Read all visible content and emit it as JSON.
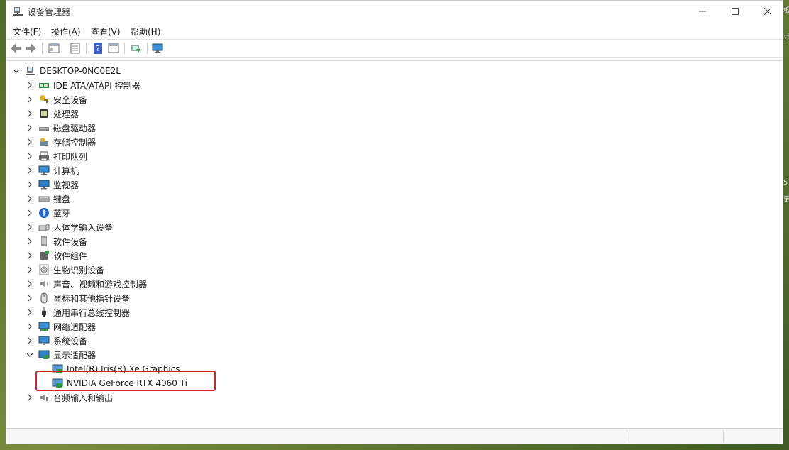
{
  "window": {
    "title": "设备管理器"
  },
  "menubar": {
    "items": [
      "文件(F)",
      "操作(A)",
      "查看(V)",
      "帮助(H)"
    ]
  },
  "tree": {
    "root": "DESKTOP-0NC0E2L",
    "categories": [
      {
        "label": "IDE ATA/ATAPI 控制器",
        "icon": "ide-controller-icon",
        "expanded": false
      },
      {
        "label": "安全设备",
        "icon": "security-key-icon",
        "expanded": false
      },
      {
        "label": "处理器",
        "icon": "processor-icon",
        "expanded": false
      },
      {
        "label": "磁盘驱动器",
        "icon": "disk-drive-icon",
        "expanded": false
      },
      {
        "label": "存储控制器",
        "icon": "storage-controller-icon",
        "expanded": false
      },
      {
        "label": "打印队列",
        "icon": "printer-icon",
        "expanded": false
      },
      {
        "label": "计算机",
        "icon": "computer-icon",
        "expanded": false
      },
      {
        "label": "监视器",
        "icon": "monitor-icon",
        "expanded": false
      },
      {
        "label": "键盘",
        "icon": "keyboard-icon",
        "expanded": false
      },
      {
        "label": "蓝牙",
        "icon": "bluetooth-icon",
        "expanded": false
      },
      {
        "label": "人体学输入设备",
        "icon": "hid-icon",
        "expanded": false
      },
      {
        "label": "软件设备",
        "icon": "software-device-icon",
        "expanded": false
      },
      {
        "label": "软件组件",
        "icon": "software-component-icon",
        "expanded": false
      },
      {
        "label": "生物识别设备",
        "icon": "fingerprint-icon",
        "expanded": false
      },
      {
        "label": "声音、视频和游戏控制器",
        "icon": "speaker-icon",
        "expanded": false
      },
      {
        "label": "鼠标和其他指针设备",
        "icon": "mouse-icon",
        "expanded": false
      },
      {
        "label": "通用串行总线控制器",
        "icon": "usb-icon",
        "expanded": false
      },
      {
        "label": "网络适配器",
        "icon": "network-adapter-icon",
        "expanded": false
      },
      {
        "label": "系统设备",
        "icon": "system-device-icon",
        "expanded": false
      },
      {
        "label": "显示适配器",
        "icon": "display-adapter-icon",
        "expanded": true,
        "children": [
          "Intel(R) Iris(R) Xe Graphics",
          "NVIDIA GeForce RTX 4060 Ti"
        ]
      },
      {
        "label": "音频输入和输出",
        "icon": "audio-io-icon",
        "expanded": false
      }
    ]
  },
  "desktop": {
    "edge_text": [
      "板",
      "寸",
      "5",
      "更"
    ]
  },
  "colors": {
    "highlight": "#e02020",
    "accent": "#2a7ad6"
  }
}
